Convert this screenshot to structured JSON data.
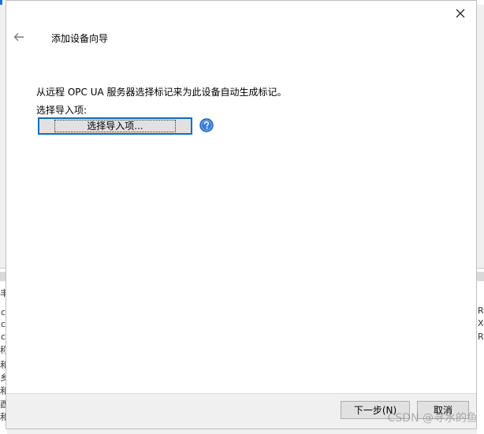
{
  "dialog": {
    "title": "添加设备向导",
    "description": "从远程 OPC UA 服务器选择标记来为此设备自动生成标记。",
    "import_label": "选择导入项:",
    "select_button_label": "选择导入项...",
    "next_button_label": "下一步(N)",
    "cancel_button_label": "取消"
  },
  "background": {
    "left_fragments": [
      "丰",
      "c",
      "c",
      "c",
      "称",
      "和",
      "乡",
      "和",
      "酉",
      "和"
    ],
    "right_fragments": [
      "R",
      "X",
      "R"
    ]
  },
  "watermark": "CSDN @寻水的鱼",
  "colors": {
    "accent": "#0a6fc2",
    "help_icon": "#3a7bd5",
    "dialog_bg": "#ffffff",
    "footer_bg": "#f0f0f0"
  },
  "icons": {
    "back": "arrow-left-icon",
    "close": "close-icon",
    "help": "help-icon"
  }
}
